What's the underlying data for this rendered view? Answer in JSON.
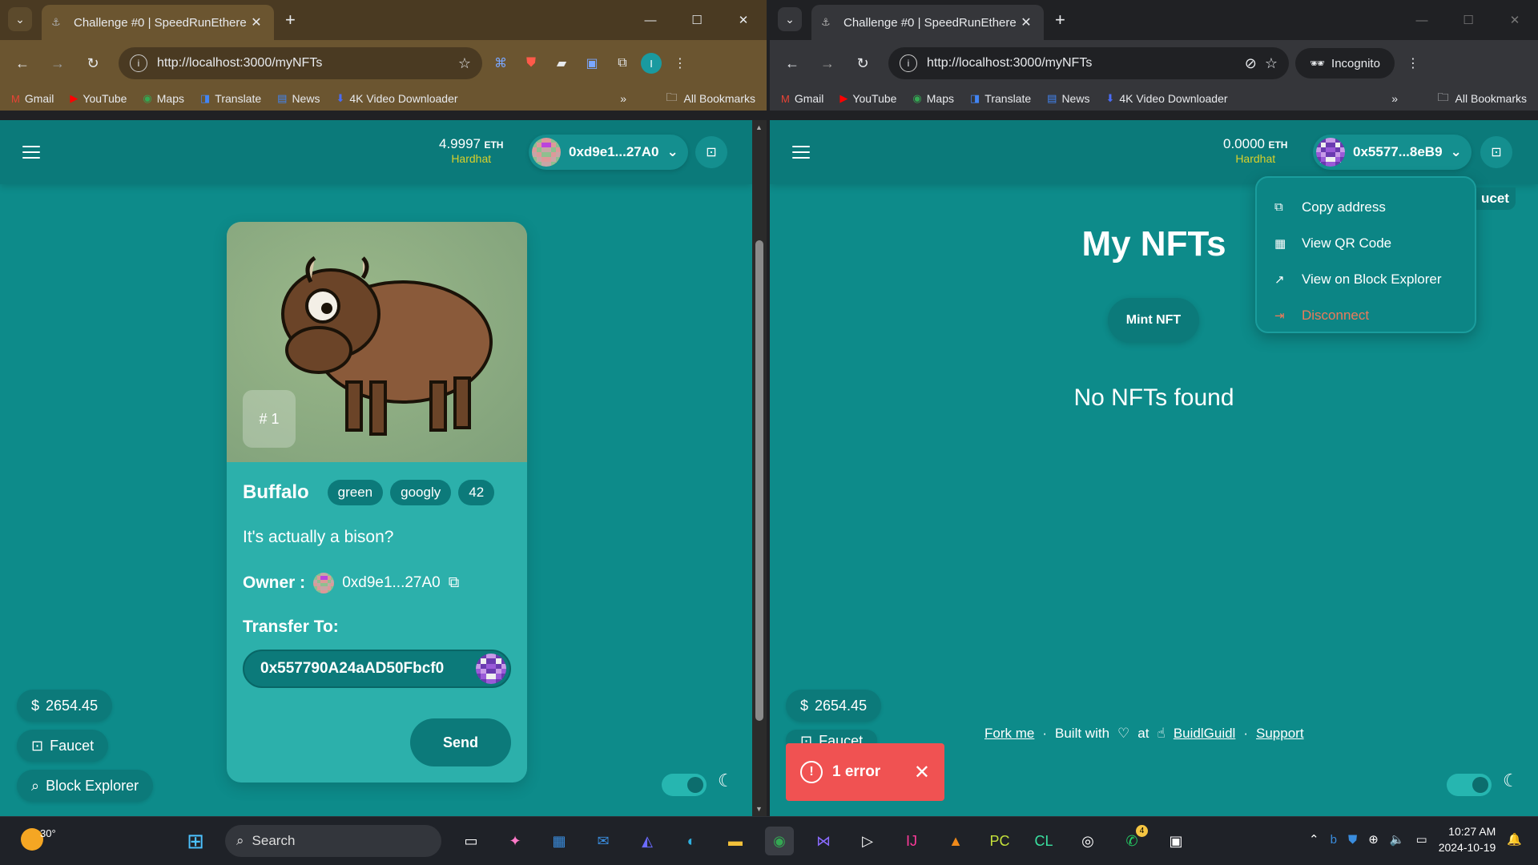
{
  "left_window": {
    "tab_title": "Challenge #0 | SpeedRunEthere",
    "url": "http://localhost:3000/myNFTs",
    "bookmarks": [
      "Gmail",
      "YouTube",
      "Maps",
      "Translate",
      "News",
      "4K Video Downloader"
    ],
    "bookmarks_all": "All Bookmarks",
    "profile_initial": "I",
    "header": {
      "balance_amount": "4.9997",
      "balance_unit": "ETH",
      "network": "Hardhat",
      "address": "0xd9e1...27A0"
    },
    "nft": {
      "badge": "# 1",
      "name": "Buffalo",
      "tags": [
        "green",
        "googly",
        "42"
      ],
      "description": "It's actually a bison?",
      "owner_label": "Owner :",
      "owner_address": "0xd9e1...27A0",
      "transfer_label": "Transfer To:",
      "transfer_value": "0x557790A24aAD50Fbcf0",
      "send_label": "Send"
    },
    "price": "2654.45",
    "faucet_label": "Faucet",
    "block_explorer_label": "Block Explorer"
  },
  "right_window": {
    "tab_title": "Challenge #0 | SpeedRunEthere",
    "url": "http://localhost:3000/myNFTs",
    "incognito_label": "Incognito",
    "bookmarks": [
      "Gmail",
      "YouTube",
      "Maps",
      "Translate",
      "News",
      "4K Video Downloader"
    ],
    "bookmarks_all": "All Bookmarks",
    "header": {
      "balance_amount": "0.0000",
      "balance_unit": "ETH",
      "network": "Hardhat",
      "address": "0x5577...8eB9",
      "faucet_partial": "ucet"
    },
    "dropdown": {
      "copy": "Copy address",
      "qr": "View QR Code",
      "explorer": "View on Block Explorer",
      "disconnect": "Disconnect"
    },
    "heading": "My NFTs",
    "mint_label": "Mint NFT",
    "empty_text": "No NFTs found",
    "price": "2654.45",
    "faucet_partial": "Faucet",
    "footer": {
      "fork": "Fork me",
      "sep": "·",
      "built_with": "Built with",
      "at": "at",
      "buidl": "BuidlGuidl",
      "support": "Support"
    },
    "error_toast": "1 error"
  },
  "taskbar": {
    "weather_temp": "30°",
    "search_placeholder": "Search",
    "whatsapp_badge": "4",
    "time": "10:27 AM",
    "date": "2024-10-19"
  }
}
